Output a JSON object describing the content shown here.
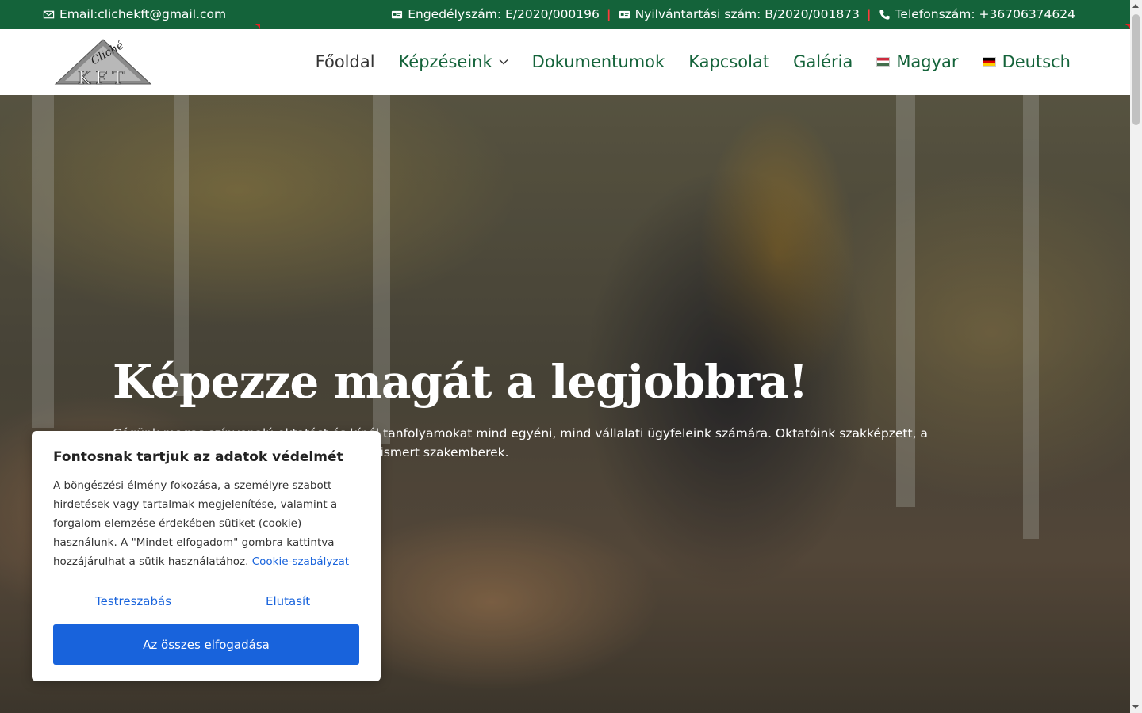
{
  "topbar": {
    "email": "Email:clichekft@gmail.com",
    "license": "Engedélyszám: E/2020/000196",
    "registry": "Nyilvántartási szám: B/2020/001873",
    "phone": "Telefonszám: +36706374624",
    "icons": [
      "envelope-icon",
      "id-card-icon",
      "id-card-icon",
      "phone-icon"
    ],
    "background_color": "#14633a",
    "separator_color": "#ff3b3b"
  },
  "nav": {
    "items": [
      {
        "label": "Főoldal"
      },
      {
        "label": "Képzéseink"
      },
      {
        "label": "Dokumentumok"
      },
      {
        "label": "Kapcsolat"
      },
      {
        "label": "Galéria"
      },
      {
        "label": "Magyar"
      },
      {
        "label": "Deutsch"
      }
    ],
    "accent_color": "#14633a"
  },
  "logo": {
    "text_top": "Cliché",
    "text_bottom": "KFT"
  },
  "hero": {
    "title": "Képezze magát a legjobbra!",
    "text": "Cégünk magas színvonalú oktatást és kínál  tanfolyamokat mind egyéni, mind vállalati ügyfeleink számára. Oktatóink szakképzett, a szakmában nagy gyakorlattal rendelkező elismert szakemberek."
  },
  "cookie": {
    "title": "Fontosnak tartjuk az adatok védelmét",
    "body": "A böngészési élmény fokozása, a személyre szabott hirdetések vagy tartalmak megjelenítése, valamint a forgalom elemzése érdekében sütiket (cookie) használunk. A \"Mindet elfogadom\" gombra kattintva hozzájárulhat a sütik használatához.",
    "policy_link": "Cookie-szabályzat",
    "customize_label": "Testreszabás",
    "reject_label": "Elutasít",
    "accept_label": "Az összes elfogadása",
    "button_color": "#1863dc"
  }
}
